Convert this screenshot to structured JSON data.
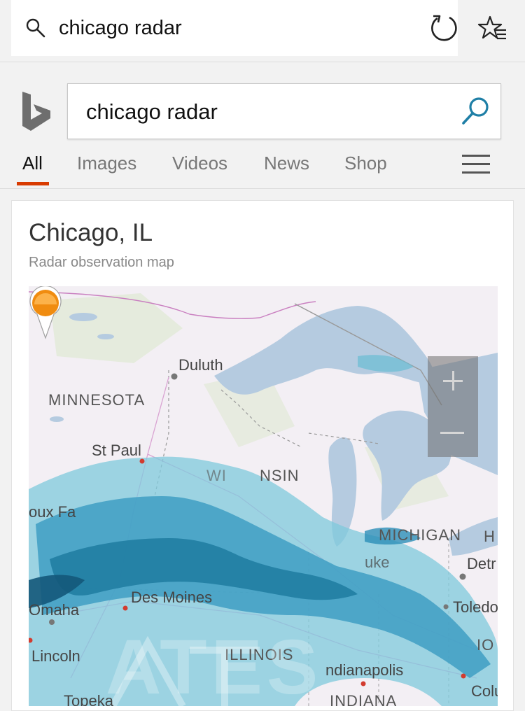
{
  "address_bar": {
    "query": "chicago radar",
    "icons": [
      "search-icon",
      "refresh-icon",
      "favorites-icon"
    ]
  },
  "bing": {
    "logo_icon": "bing-logo-icon",
    "search_value": "chicago radar",
    "search_icon": "search-icon",
    "tabs": [
      {
        "label": "All",
        "active": true
      },
      {
        "label": "Images",
        "active": false
      },
      {
        "label": "Videos",
        "active": false
      },
      {
        "label": "News",
        "active": false
      },
      {
        "label": "Shop",
        "active": false
      }
    ],
    "menu_icon": "hamburger-icon",
    "accent_color": "#d83b01"
  },
  "card": {
    "title": "Chicago, IL",
    "subtitle": "Radar observation map",
    "map": {
      "zoom_in": "+",
      "zoom_out": "−",
      "cities": {
        "duluth": "Duluth",
        "st_paul": "St Paul",
        "sioux_falls": "oux Fa",
        "des_moines": "Des Moines",
        "omaha": "Omaha",
        "lincoln": "Lincoln",
        "topeka": "Topeka",
        "indianapolis": "ndianapolis",
        "detroit": "Detr",
        "toledo": "Toledo",
        "columbus": "Colu",
        "chicago_partial": "uke"
      },
      "states": {
        "minnesota": "MINNESOTA",
        "wisconsin": "NSIN",
        "wisconsin_partial": "WI",
        "michigan": "MICHIGAN",
        "illinois": "ILLINOIS",
        "indiana": "INDIANA",
        "ohio": "IO",
        "h": "H"
      },
      "watermark": "ATES",
      "colors": {
        "water": "#b5cbe0",
        "land": "#f3eff4",
        "radar_light": "#7fc9dc",
        "radar_dark": "#1f7ba0",
        "pin": "#f08c10"
      }
    }
  }
}
